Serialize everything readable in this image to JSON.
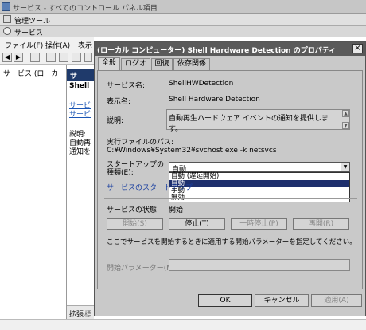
{
  "window": {
    "title": "サービス - すべてのコントロール パネル項目"
  },
  "mmc": {
    "title": "管理ツール",
    "services_title": "サービス"
  },
  "menubar": {
    "file": "ファイル(F)",
    "action": "操作(A)",
    "view": "表示"
  },
  "toolbar": {
    "back": "◀",
    "forward": "▶"
  },
  "tree": {
    "root": "サービス (ローカ"
  },
  "middle": {
    "header": "サ",
    "service_label": "Shell",
    "link1": "サービ",
    "link2": "サービ",
    "desc_label": "説明:",
    "desc_line1": "自動再",
    "desc_line2": "通知を",
    "tab_extended": "拡張",
    "tab_standard": "標準"
  },
  "dialog": {
    "title": "(ローカル コンピューター) Shell Hardware Detection のプロパティ",
    "close": "×",
    "tabs": {
      "general": "全般",
      "logon": "ログオン",
      "recovery": "回復",
      "dependencies": "依存関係"
    },
    "service_name_label": "サービス名:",
    "service_name": "ShellHWDetection",
    "display_name_label": "表示名:",
    "display_name": "Shell Hardware Detection",
    "description_label": "説明:",
    "description": "自動再生ハードウェア イベントの通知を提供します。",
    "path_label": "実行ファイルのパス:",
    "path": "C:¥Windows¥System32¥svchost.exe -k netsvcs",
    "startup_label_line1": "スタートアップの",
    "startup_label_line2": "種類(E):",
    "startup_value": "自動",
    "startup_options": [
      "自動 (遅延開始)",
      "自動",
      "手動",
      "無効"
    ],
    "startup_selected_index": 1,
    "startup_help_link": "サービスのスタートアップ",
    "status_label": "サービスの状態:",
    "status_value": "開始",
    "btn_start": "開始(S)",
    "btn_stop": "停止(T)",
    "btn_pause": "一時停止(P)",
    "btn_resume": "再開(R)",
    "param_note": "ここでサービスを開始するときに適用する開始パラメーターを指定してください。",
    "param_label": "開始パラメーター(M):",
    "param_value": "",
    "ok": "OK",
    "cancel": "キャンセル",
    "apply": "適用(A)"
  }
}
